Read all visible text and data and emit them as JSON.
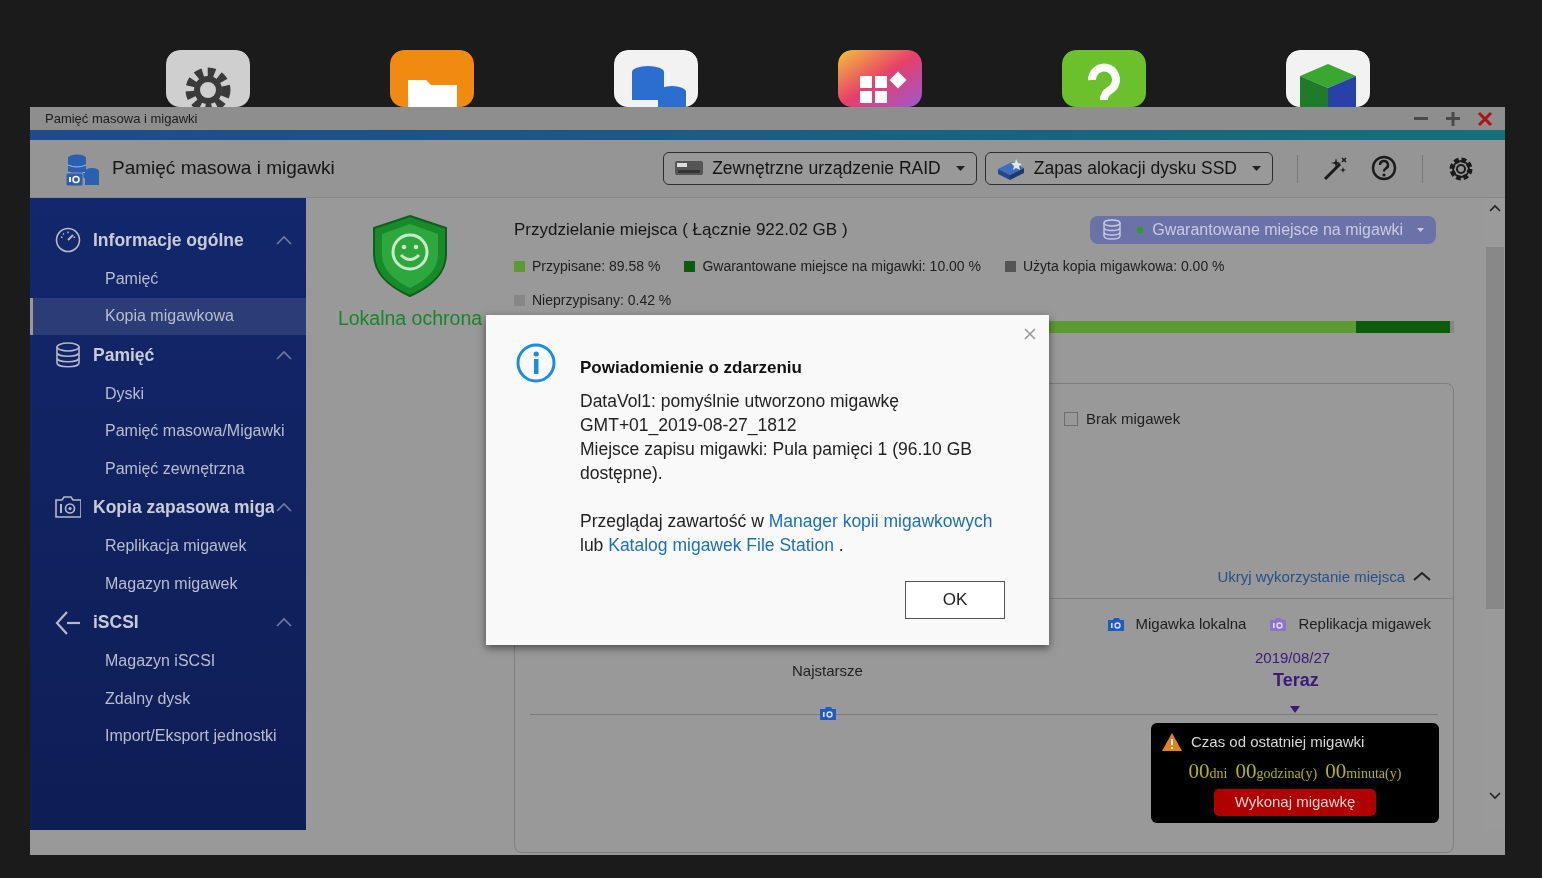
{
  "window": {
    "title": "Pamięć masowa i migawki"
  },
  "header": {
    "title": "Pamięć masowa i migawki",
    "menus": [
      {
        "label": "Zewnętrzne urządzenie RAID",
        "kind": "raid"
      },
      {
        "label": "Zapas alokacji dysku SSD",
        "kind": "ssd"
      }
    ]
  },
  "sidebar": {
    "sections": [
      {
        "label": "Informacje ogólne",
        "kind": "gauge",
        "expanded": true,
        "children": [
          {
            "label": "Pamięć",
            "selected": false
          },
          {
            "label": "Kopia migawkowa",
            "selected": true
          }
        ]
      },
      {
        "label": "Pamięć",
        "kind": "database",
        "expanded": true,
        "children": [
          {
            "label": "Dyski",
            "selected": false
          },
          {
            "label": "Pamięć masowa/Migawki",
            "selected": false
          },
          {
            "label": "Pamięć zewnętrzna",
            "selected": false
          }
        ]
      },
      {
        "label": "Kopia zapasowa miga",
        "kind": "camera",
        "expanded": true,
        "children": [
          {
            "label": "Replikacja migawek",
            "selected": false
          },
          {
            "label": "Magazyn migawek",
            "selected": false
          }
        ]
      },
      {
        "label": "iSCSI",
        "kind": "iscsi",
        "expanded": true,
        "children": [
          {
            "label": "Magazyn iSCSI",
            "selected": false
          },
          {
            "label": "Zdalny dysk",
            "selected": false
          },
          {
            "label": "Import/Eksport jednostki",
            "selected": false
          }
        ]
      }
    ]
  },
  "protection": {
    "label": "Lokalna ochrona"
  },
  "allocation": {
    "title": "Przydzielanie miejsca ( Łącznie 922.02 GB )",
    "filter": {
      "label": "Gwarantowane miejsce na migawki",
      "color": "#2f9a2f"
    },
    "segments": [
      {
        "label": "Przypisane: 89.58 %",
        "color": "#5e9a32",
        "level": 0.8958
      },
      {
        "label": "Gwarantowane miejsce na migawki: 10.00 %",
        "color": "#0b5c0b",
        "level": 0.1
      },
      {
        "label": "Użyta kopia migawkowa: 0.00 %",
        "color": "#555555",
        "level": 0
      },
      {
        "label": "Nieprzypisany: 0.42 %",
        "color": "#878787",
        "level": 0.0042
      }
    ]
  },
  "snapshots": {
    "empty": {
      "label": "Brak migawek",
      "checked": false
    },
    "hide_link": "Ukryj wykorzystanie miejsca",
    "legend": [
      {
        "label": "Migawka lokalna",
        "color": "#1d5cc4"
      },
      {
        "label": "Replikacja migawek",
        "color": "#8c74cc"
      }
    ],
    "oldest": "Najstarsze",
    "date": "2019/08/27",
    "now": "Teraz"
  },
  "tooltip": {
    "title": "Czas od ostatniej migawki",
    "counters": [
      {
        "value": "00",
        "unit": "dni"
      },
      {
        "value": "00",
        "unit": "godzina(y)"
      },
      {
        "value": "00",
        "unit": "minuta(y)"
      }
    ],
    "button": "Wykonaj migawkę"
  },
  "dialog": {
    "title": "Powiadomienie o zdarzeniu",
    "lines": [
      "DataVol1: pomyślnie utworzono migawkę GMT+01_2019-08-27_1812",
      "Miejsce zapisu migawki: Pula pamięci 1 (96.10 GB dostępne)."
    ],
    "browse": {
      "prefix": "Przeglądaj zawartość w",
      "link1": "Manager kopii migawkowych",
      "middle": "lub",
      "link2": "Katalog migawek File Station",
      "suffix": "."
    },
    "ok": "OK"
  }
}
